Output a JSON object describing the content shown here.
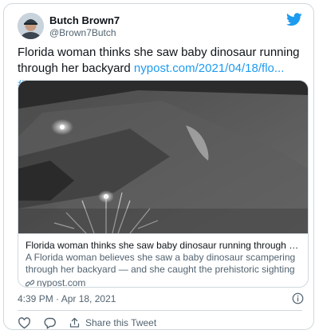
{
  "tweet": {
    "author_name": "Butch Brown7",
    "author_handle": "@Brown7Butch",
    "text_plain": "Florida woman thinks she saw baby dinosaur running through her backyard ",
    "link_text": "nypost.com/2021/04/18/flo...",
    "hashtag": "#SmartNews",
    "timestamp": "4:39 PM · Apr 18, 2021"
  },
  "link_card": {
    "title": "Florida woman thinks she saw baby dinosaur running through her backya...",
    "description": "A Florida woman believes she saw a baby dinosaur scampering through her backyard — and she caught the prehistoric sighting on video, reports...",
    "domain": "nypost.com"
  },
  "actions": {
    "share_label": "Share this Tweet"
  },
  "icons": {
    "brand": "twitter-bird-icon",
    "info": "info-icon",
    "like": "heart-icon",
    "reply": "reply-bubble-icon",
    "share": "share-icon",
    "link": "link-icon"
  },
  "colors": {
    "accent": "#1d9bf0",
    "text": "#0f1419",
    "secondary": "#536471",
    "border": "#cfd9de"
  }
}
